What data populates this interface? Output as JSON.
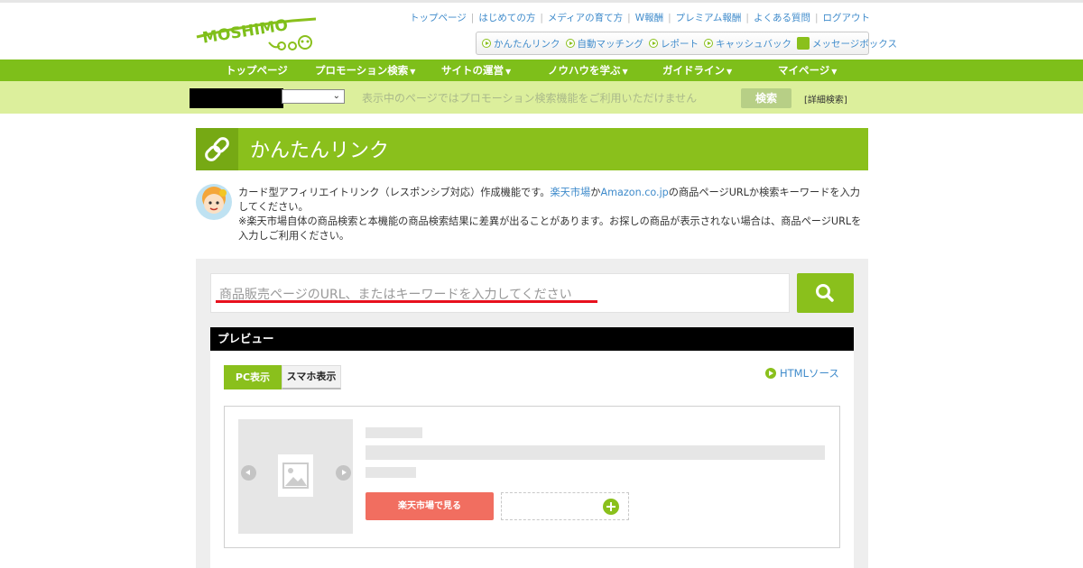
{
  "brand": {
    "logo_text": "MOSHIMO",
    "accent": "#8ac01c",
    "nav_green": "#7ebf1a"
  },
  "toplinks": [
    "トップページ",
    "はじめての方",
    "メディアの育て方",
    "W報酬",
    "プレミアム報酬",
    "よくある質問",
    "ログアウト"
  ],
  "quicklinks": [
    {
      "label": "かんたんリンク",
      "icon": "play-circle-icon"
    },
    {
      "label": "自動マッチング",
      "icon": "play-circle-icon"
    },
    {
      "label": "レポート",
      "icon": "play-circle-icon"
    },
    {
      "label": "キャッシュバック",
      "icon": "play-circle-icon"
    },
    {
      "label": "メッセージボックス",
      "icon": "thumbs-up-icon"
    }
  ],
  "nav": [
    {
      "label": "トップページ",
      "arrow": ""
    },
    {
      "label": "プロモーション検索",
      "arrow": "▼"
    },
    {
      "label": "サイトの運営",
      "arrow": "▼"
    },
    {
      "label": "ノウハウを学ぶ",
      "arrow": "▼"
    },
    {
      "label": "ガイドライン",
      "arrow": "▼"
    },
    {
      "label": "マイページ",
      "arrow": "▼"
    }
  ],
  "subbar": {
    "notice": "表示中のページではプロモーション検索機能をご利用いただけません",
    "search_button": "検索",
    "detail_link": "[詳細検索]"
  },
  "page": {
    "title": "かんたんリンク",
    "description": {
      "line1_pre": "カード型アフィリエイトリンク（レスポンシブ対応）作成機能です。",
      "link1": "楽天市場",
      "mid1": "か",
      "link2": "Amazon.co.jp",
      "line1_post": "の商品ページURLか検索キーワードを入力してください。",
      "note": "※楽天市場自体の商品検索と本機能の商品検索結果に差異が出ることがあります。お探しの商品が表示されない場合は、商品ページURLを入力しご利用ください。"
    }
  },
  "search": {
    "placeholder": "商品販売ページのURL、またはキーワードを入力してください"
  },
  "preview": {
    "header": "プレビュー",
    "tab_pc": "PC表示",
    "tab_sp": "スマホ表示",
    "html_source": "HTMLソース",
    "rakuten_button": "楽天市場で見る"
  }
}
